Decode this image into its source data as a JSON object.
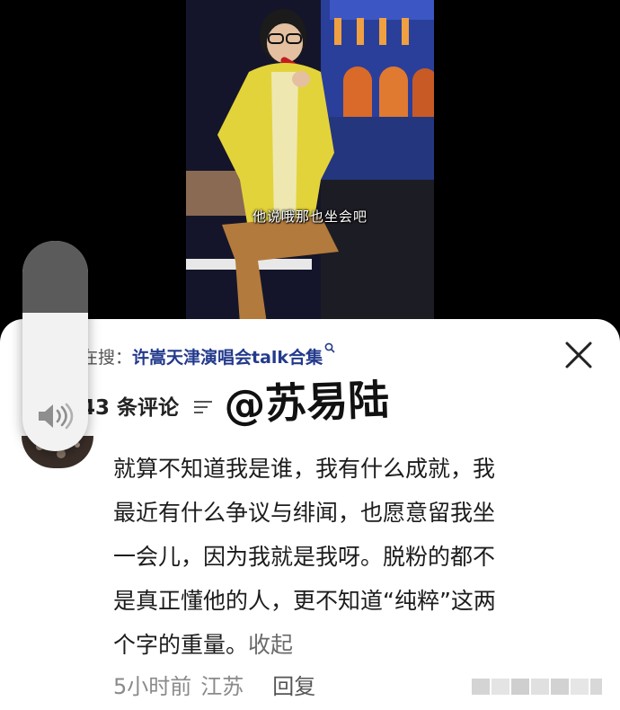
{
  "video": {
    "subtitle": "他说哦那也坐会吧"
  },
  "panel": {
    "search_prefix": "在搜：",
    "search_term": "许嵩天津演唱会talk合集",
    "comment_count": "43 条评论",
    "watermark": "@苏易陆"
  },
  "comment": {
    "lines": [
      "就算不知道我是谁，我有什么成就，我",
      "最近有什么争议与绯闻，也愿意留我坐",
      "一会儿，因为我就是我呀。脱粉的都不",
      "是真正懂他的人，更不知道“纯粹”这两",
      "个字的重量。"
    ],
    "collapse_label": "收起",
    "time": "5小时前",
    "location": "江苏",
    "reply_label": "回复"
  },
  "volume": {
    "level_fraction": 0.66
  },
  "icons": {
    "search": "search-icon",
    "close": "close-icon",
    "sort": "sort-icon",
    "volume": "speaker-icon"
  }
}
